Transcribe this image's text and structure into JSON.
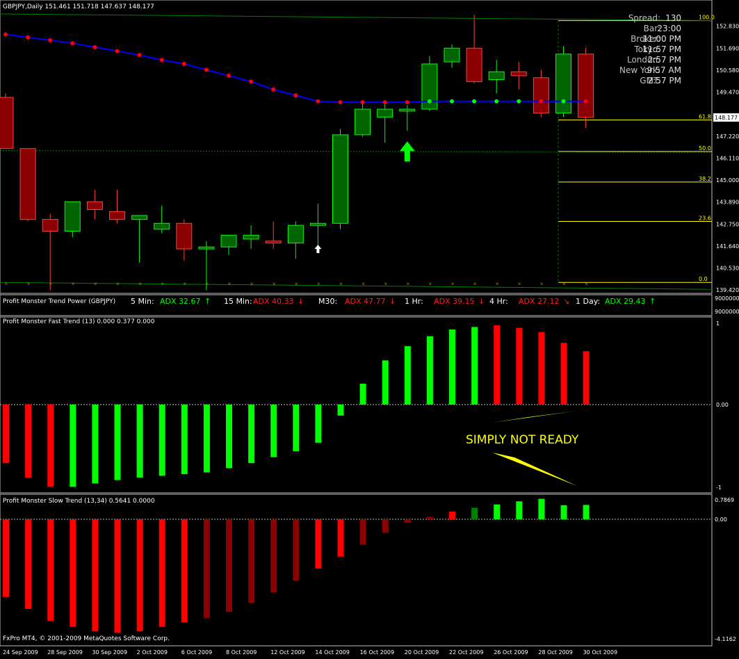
{
  "chart_title": "GBPJPY,Daily  151.461 151.718 147.637 148.177",
  "footer_copyright": "FxPro MT4, © 2001-2009 MetaQuotes Software Corp.",
  "info_box": [
    {
      "label": "Spread:",
      "value": "130"
    },
    {
      "label": "Bar:",
      "value": "23:00"
    },
    {
      "label": "Broker:",
      "value": "11:00 PM"
    },
    {
      "label": "Tokyo:",
      "value": "11:57 PM"
    },
    {
      "label": "London:",
      "value": "2:57 PM"
    },
    {
      "label": "New York:",
      "value": "9:57 AM"
    },
    {
      "label": "GMT:",
      "value": "2:57 PM"
    }
  ],
  "trend_power": {
    "title": "Profit Monster Trend Power (GBPJPY)",
    "items": [
      {
        "tf": "5 Min:",
        "adx": "ADX 32.67",
        "dir": "up",
        "color": "#00ff00"
      },
      {
        "tf": "15 Min:",
        "adx": "ADX 40.33",
        "dir": "down",
        "color": "#ff2020"
      },
      {
        "tf": "M30:",
        "adx": "ADX 47.77",
        "dir": "down",
        "color": "#ff2020"
      },
      {
        "tf": "1 Hr:",
        "adx": "ADX 39.15",
        "dir": "down",
        "color": "#ff2020"
      },
      {
        "tf": "4 Hr:",
        "adx": "ADX 27.12",
        "dir": "down-right",
        "color": "#ff2020"
      },
      {
        "tf": "1 Day:",
        "adx": "ADX 29.43",
        "dir": "up",
        "color": "#00ff00"
      }
    ],
    "scale_labels": [
      "9000000",
      "9000000"
    ]
  },
  "fast_trend_title": "Profit Monster Fast Trend (13) 0.000 0.377 0.000",
  "slow_trend_title": "Profit Monster Slow Trend (13,34) 0.5641 0.0000",
  "annotation": "SIMPLY NOT READY",
  "colors": {
    "bull": "#006400",
    "bull_border": "#00ff00",
    "bear": "#8b0000",
    "bear_border": "#ff4040",
    "red": "#ff0000",
    "green": "#00ff00",
    "dark_red": "#8b0000",
    "dark_green": "#008000",
    "ma_line": "#0000ff",
    "fib": "#ffff00",
    "annotation": "#ffff00"
  },
  "chart_data": [
    {
      "type": "candlestick",
      "ylim": [
        139.42,
        153.44
      ],
      "y_ticks": [
        "152.830",
        "151.690",
        "150.580",
        "149.470",
        "148.177",
        "147.220",
        "146.110",
        "145.000",
        "143.890",
        "142.750",
        "141.640",
        "140.530",
        "139.420"
      ],
      "x_ticks": [
        "24 Sep 2009",
        "28 Sep 2009",
        "30 Sep 2009",
        "2 Oct 2009",
        "6 Oct 2009",
        "8 Oct 2009",
        "12 Oct 2009",
        "14 Oct 2009",
        "16 Oct 2009",
        "20 Oct 2009",
        "22 Oct 2009",
        "26 Oct 2009",
        "28 Oct 2009",
        "30 Oct 2009"
      ],
      "candles": [
        {
          "o": 149.2,
          "h": 149.4,
          "l": 146.6,
          "c": 146.6
        },
        {
          "o": 146.6,
          "h": 146.6,
          "l": 142.9,
          "c": 143.0
        },
        {
          "o": 143.0,
          "h": 143.3,
          "l": 139.4,
          "c": 142.4
        },
        {
          "o": 142.4,
          "h": 143.9,
          "l": 142.1,
          "c": 143.9
        },
        {
          "o": 143.9,
          "h": 144.5,
          "l": 143.0,
          "c": 143.5
        },
        {
          "o": 143.4,
          "h": 144.5,
          "l": 142.8,
          "c": 143.0
        },
        {
          "o": 143.0,
          "h": 143.2,
          "l": 140.8,
          "c": 143.2
        },
        {
          "o": 142.5,
          "h": 143.7,
          "l": 142.3,
          "c": 142.8
        },
        {
          "o": 142.8,
          "h": 143.0,
          "l": 140.9,
          "c": 141.5
        },
        {
          "o": 141.5,
          "h": 141.9,
          "l": 139.4,
          "c": 141.6
        },
        {
          "o": 141.6,
          "h": 142.2,
          "l": 141.2,
          "c": 142.2
        },
        {
          "o": 142.0,
          "h": 142.7,
          "l": 141.5,
          "c": 142.2
        },
        {
          "o": 141.9,
          "h": 142.9,
          "l": 141.5,
          "c": 141.8
        },
        {
          "o": 141.8,
          "h": 142.9,
          "l": 141.0,
          "c": 142.7
        },
        {
          "o": 142.7,
          "h": 143.8,
          "l": 141.3,
          "c": 142.8
        },
        {
          "o": 142.8,
          "h": 147.6,
          "l": 142.5,
          "c": 147.3
        },
        {
          "o": 147.3,
          "h": 149.0,
          "l": 147.2,
          "c": 148.6
        },
        {
          "o": 148.2,
          "h": 149.0,
          "l": 146.9,
          "c": 148.6
        },
        {
          "o": 148.5,
          "h": 148.8,
          "l": 147.5,
          "c": 148.6
        },
        {
          "o": 148.6,
          "h": 151.3,
          "l": 148.5,
          "c": 150.9
        },
        {
          "o": 151.0,
          "h": 151.9,
          "l": 150.7,
          "c": 151.7
        },
        {
          "o": 151.7,
          "h": 153.4,
          "l": 149.9,
          "c": 150.0
        },
        {
          "o": 150.1,
          "h": 151.1,
          "l": 149.4,
          "c": 150.5
        },
        {
          "o": 150.5,
          "h": 151.0,
          "l": 149.6,
          "c": 150.3
        },
        {
          "o": 150.2,
          "h": 150.6,
          "l": 148.2,
          "c": 148.4
        },
        {
          "o": 148.4,
          "h": 151.8,
          "l": 148.2,
          "c": 151.4
        },
        {
          "o": 151.4,
          "h": 151.72,
          "l": 147.64,
          "c": 148.18
        }
      ],
      "ma_line": [
        152.4,
        152.25,
        152.1,
        151.95,
        151.75,
        151.55,
        151.35,
        151.1,
        150.9,
        150.6,
        150.3,
        150.0,
        149.6,
        149.3,
        149.0,
        148.95,
        148.95,
        148.95,
        148.95,
        149.0,
        149.0,
        149.0,
        149.0,
        149.0,
        149.0,
        149.0,
        149.0
      ],
      "ma_dot_colors": [
        "#ff0000",
        "#ff0000",
        "#ff0000",
        "#ff0000",
        "#ff0000",
        "#ff0000",
        "#ff0000",
        "#ff0000",
        "#ff0000",
        "#ff0000",
        "#ff0000",
        "#ff0000",
        "#ff0000",
        "#ff0000",
        "#ff0000",
        "#ff0000",
        "#ff0000",
        "#ff0000",
        "#ff0000",
        "#00ff00",
        "#00ff00",
        "#00ff00",
        "#00ff00",
        "#00ff00",
        "#ff0000",
        "#00ff00",
        "#ff0000"
      ],
      "fib_levels": [
        {
          "label": "100.0",
          "price": 153.1
        },
        {
          "label": "61.8",
          "price": 148.05
        },
        {
          "label": "50.0",
          "price": 146.45
        },
        {
          "label": "38.2",
          "price": 144.9
        },
        {
          "label": "23.6",
          "price": 142.9
        },
        {
          "label": "0.0",
          "price": 139.8
        }
      ],
      "arrows": [
        {
          "bar": 14,
          "price": 141.5,
          "color": "#ffffff",
          "size": "small"
        },
        {
          "bar": 18,
          "price": 146.4,
          "color": "#00ff00",
          "size": "large"
        }
      ]
    },
    {
      "type": "histogram",
      "name": "Profit Monster Fast Trend (13)",
      "ylim": [
        -1,
        1
      ],
      "y_ticks": [
        "1",
        "0.00",
        "-1"
      ],
      "values": [
        -0.69,
        -0.86,
        -0.97,
        -0.97,
        -0.93,
        -0.89,
        -0.86,
        -0.84,
        -0.82,
        -0.8,
        -0.75,
        -0.69,
        -0.62,
        -0.55,
        -0.45,
        -0.13,
        0.25,
        0.53,
        0.7,
        0.82,
        0.9,
        0.93,
        0.95,
        0.92,
        0.87,
        0.74,
        0.64,
        0.47
      ],
      "colors": [
        "#ff0000",
        "#ff0000",
        "#ff0000",
        "#00ff00",
        "#00ff00",
        "#00ff00",
        "#00ff00",
        "#00ff00",
        "#00ff00",
        "#00ff00",
        "#00ff00",
        "#00ff00",
        "#00ff00",
        "#00ff00",
        "#00ff00",
        "#00ff00",
        "#00ff00",
        "#00ff00",
        "#00ff00",
        "#00ff00",
        "#00ff00",
        "#00ff00",
        "#ff0000",
        "#ff0000",
        "#ff0000",
        "#ff0000",
        "#ff0000"
      ]
    },
    {
      "type": "histogram",
      "name": "Profit Monster Slow Trend (13,34)",
      "ylim": [
        -4.1162,
        0.7869
      ],
      "y_ticks": [
        "0.7869",
        "0.00",
        "-4.1162"
      ],
      "values": [
        -2.6,
        -3.0,
        -3.4,
        -3.6,
        -3.75,
        -3.8,
        -3.75,
        -3.6,
        -3.45,
        -3.3,
        -3.1,
        -2.8,
        -2.45,
        -2.05,
        -1.65,
        -1.25,
        -0.85,
        -0.45,
        -0.12,
        0.1,
        0.3,
        0.45,
        0.58,
        0.7,
        0.8,
        0.55,
        0.56
      ],
      "colors": [
        "#ff0000",
        "#ff0000",
        "#ff0000",
        "#ff0000",
        "#ff0000",
        "#ff0000",
        "#ff0000",
        "#ff0000",
        "#ff0000",
        "#8b0000",
        "#8b0000",
        "#8b0000",
        "#8b0000",
        "#8b0000",
        "#ff0000",
        "#ff0000",
        "#8b0000",
        "#8b0000",
        "#8b0000",
        "#8b0000",
        "#ff0000",
        "#008000",
        "#00ff00",
        "#00ff00",
        "#00ff00",
        "#00ff00",
        "#00ff00"
      ]
    }
  ]
}
